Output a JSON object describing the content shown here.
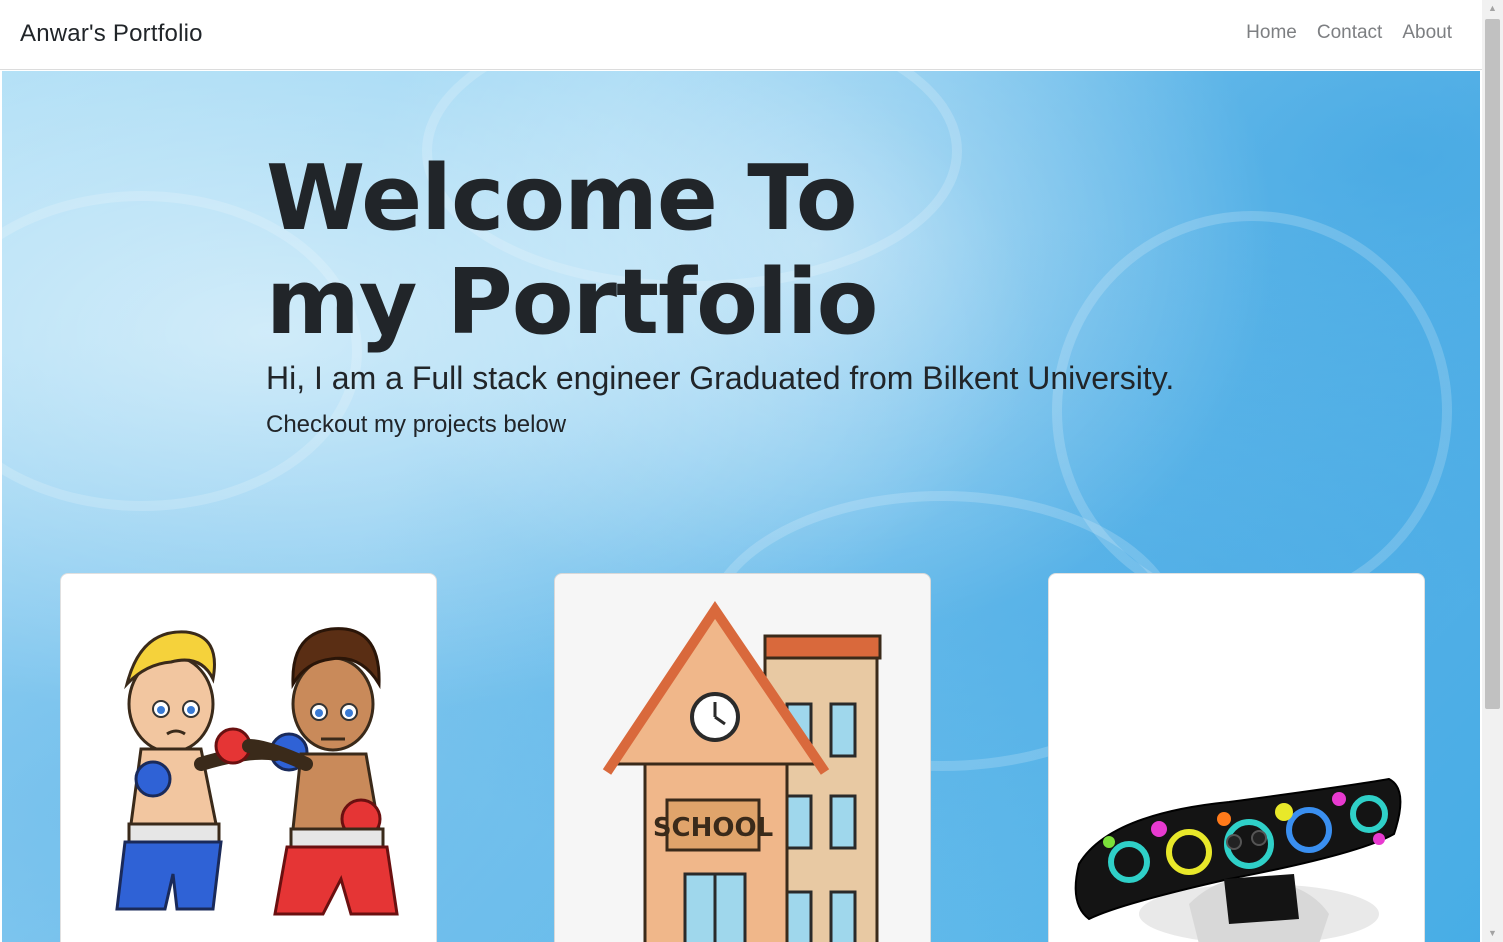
{
  "navbar": {
    "brand": "Anwar's Portfolio",
    "links": [
      "Home",
      "Contact",
      "About"
    ]
  },
  "hero": {
    "title": "Welcome To my Portfolio",
    "lead": "Hi, I am a Full stack engineer Graduated from Bilkent University.",
    "sub": "Checkout my projects below"
  },
  "projects": [
    {
      "image": "boxing-kids-illustration"
    },
    {
      "image": "school-building-illustration",
      "sign_text": "SCHOOL"
    },
    {
      "image": "kinect-sensor-illustration"
    }
  ],
  "colors": {
    "hero_blue": "#6cbfec",
    "text_dark": "#212529",
    "nav_link": "#7d7f82"
  }
}
